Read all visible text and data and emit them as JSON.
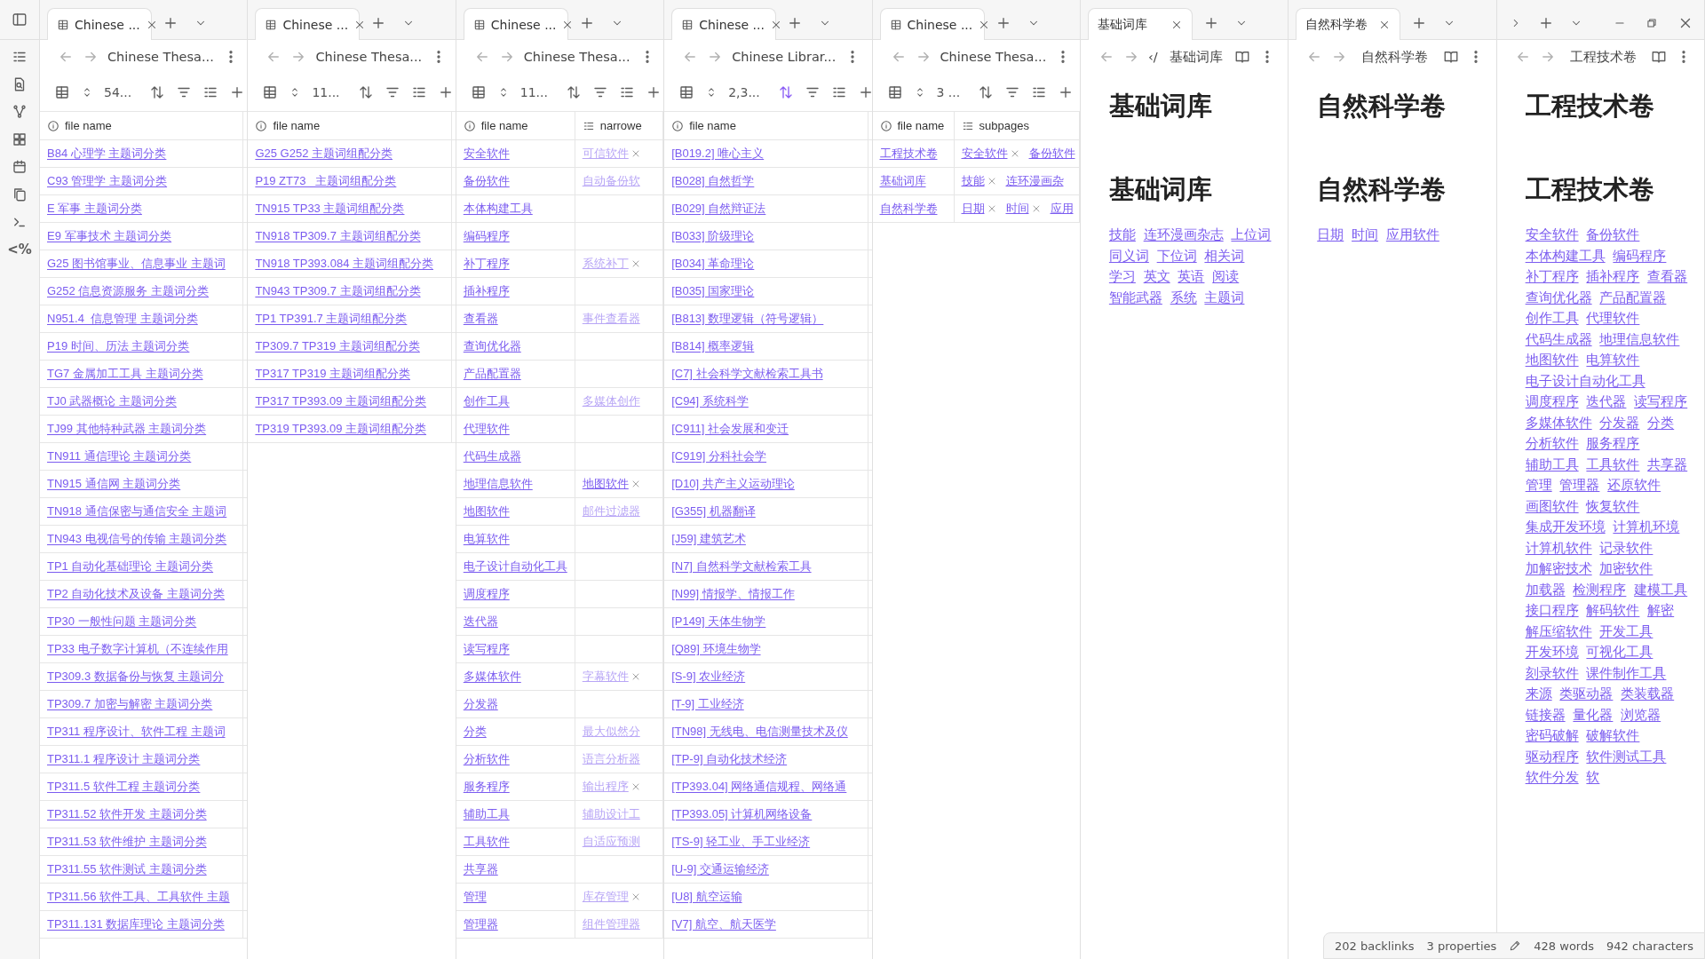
{
  "ribbon": {
    "icons": [
      {
        "kind": "sidebar"
      },
      {
        "kind": "list"
      },
      {
        "kind": "file-search"
      },
      {
        "kind": "graph"
      },
      {
        "kind": "grid"
      },
      {
        "kind": "calendar"
      },
      {
        "kind": "copy"
      },
      {
        "kind": "terminal"
      },
      {
        "kind": "text",
        "label": "<%"
      }
    ]
  },
  "panes": [
    {
      "kind": "table",
      "tab_bar": {
        "tab": {
          "title": "Chinese ..."
        }
      },
      "nav": {
        "title": "Chinese Thesa..."
      },
      "toolbar": {
        "count": "54...",
        "sort_active": false
      },
      "columns": [
        {
          "label": "file name",
          "kind": "file"
        }
      ],
      "rows": [
        {
          "name": "B84 心理学 主题词分类"
        },
        {
          "name": "C93 管理学 主题词分类"
        },
        {
          "name": "E 军事 主题词分类"
        },
        {
          "name": "E9 军事技术 主题词分类"
        },
        {
          "name": "G25 图书馆事业、信息事业 主题词"
        },
        {
          "name": "G252 信息资源服务 主题词分类"
        },
        {
          "name": "N951.4_信息管理 主题词分类"
        },
        {
          "name": "P19 时间、历法 主题词分类"
        },
        {
          "name": "TG7 金属加工工具 主题词分类"
        },
        {
          "name": "TJ0 武器概论 主题词分类"
        },
        {
          "name": "TJ99 其他特种武器 主题词分类"
        },
        {
          "name": "TN911 通信理论 主题词分类"
        },
        {
          "name": "TN915 通信网 主题词分类"
        },
        {
          "name": "TN918 通信保密与通信安全 主题词"
        },
        {
          "name": "TN943 电视信号的传输 主题词分类"
        },
        {
          "name": "TP1 自动化基础理论 主题词分类"
        },
        {
          "name": "TP2 自动化技术及设备 主题词分类"
        },
        {
          "name": "TP30 一般性问题 主题词分类"
        },
        {
          "name": "TP33 电子数字计算机（不连续作用"
        },
        {
          "name": "TP309.3 数据备份与恢复 主题词分"
        },
        {
          "name": "TP309.7 加密与解密 主题词分类"
        },
        {
          "name": "TP311 程序设计、软件工程 主题词"
        },
        {
          "name": "TP311.1 程序设计 主题词分类"
        },
        {
          "name": "TP311.5 软件工程 主题词分类"
        },
        {
          "name": "TP311.52 软件开发 主题词分类"
        },
        {
          "name": "TP311.53 软件维护 主题词分类"
        },
        {
          "name": "TP311.55 软件测试 主题词分类"
        },
        {
          "name": "TP311.56 软件工具、工具软件 主题"
        },
        {
          "name": "TP311.131 数据库理论 主题词分类"
        }
      ]
    },
    {
      "kind": "table",
      "tab_bar": {
        "tab": {
          "title": "Chinese ..."
        }
      },
      "nav": {
        "title": "Chinese Thesa..."
      },
      "toolbar": {
        "count": "11...",
        "sort_active": false
      },
      "columns": [
        {
          "label": "file name",
          "kind": "file"
        }
      ],
      "rows": [
        {
          "name": "G25 G252 主题词组配分类"
        },
        {
          "name": "P19 ZT73_ 主题词组配分类"
        },
        {
          "name": "TN915 TP33 主题词组配分类"
        },
        {
          "name": "TN918 TP309.7 主题词组配分类"
        },
        {
          "name": "TN918 TP393.084 主题词组配分类"
        },
        {
          "name": "TN943 TP309.7 主题词组配分类"
        },
        {
          "name": "TP1 TP391.7 主题词组配分类"
        },
        {
          "name": "TP309.7 TP319 主题词组配分类"
        },
        {
          "name": "TP317 TP319 主题词组配分类"
        },
        {
          "name": "TP317 TP393.09 主题词组配分类"
        },
        {
          "name": "TP319 TP393.09 主题词组配分类"
        }
      ]
    },
    {
      "kind": "table",
      "tab_bar": {
        "tab": {
          "title": "Chinese ..."
        }
      },
      "nav": {
        "title": "Chinese Thesa..."
      },
      "toolbar": {
        "count": "11...",
        "sort_active": false
      },
      "columns": [
        {
          "label": "file name",
          "kind": "file"
        },
        {
          "label": "narrowe",
          "kind": "list"
        }
      ],
      "rows": [
        {
          "name": "安全软件",
          "chips": [
            {
              "text": "可信软件",
              "resolved": false,
              "removable": true
            }
          ]
        },
        {
          "name": "备份软件",
          "chips": [
            {
              "text": "自动备份软",
              "resolved": false,
              "removable": false
            }
          ]
        },
        {
          "name": "本体构建工具"
        },
        {
          "name": "编码程序"
        },
        {
          "name": "补丁程序",
          "chips": [
            {
              "text": "系统补丁",
              "resolved": false,
              "removable": true
            }
          ]
        },
        {
          "name": "插补程序"
        },
        {
          "name": "查看器",
          "chips": [
            {
              "text": "事件查看器",
              "resolved": false,
              "removable": false
            }
          ]
        },
        {
          "name": "查询优化器"
        },
        {
          "name": "产品配置器"
        },
        {
          "name": "创作工具",
          "chips": [
            {
              "text": "多媒体创作",
              "resolved": false,
              "removable": false
            }
          ]
        },
        {
          "name": "代理软件"
        },
        {
          "name": "代码生成器"
        },
        {
          "name": "地理信息软件",
          "chips": [
            {
              "text": "地图软件",
              "resolved": true,
              "removable": true
            }
          ]
        },
        {
          "name": "地图软件",
          "chips": [
            {
              "text": "邮件过滤器",
              "resolved": false,
              "removable": false
            }
          ]
        },
        {
          "name": "电算软件"
        },
        {
          "name": "电子设计自动化工具"
        },
        {
          "name": "调度程序"
        },
        {
          "name": "迭代器"
        },
        {
          "name": "读写程序"
        },
        {
          "name": "多媒体软件",
          "chips": [
            {
              "text": "字幕软件",
              "resolved": false,
              "removable": true
            }
          ]
        },
        {
          "name": "分发器"
        },
        {
          "name": "分类",
          "chips": [
            {
              "text": "最大似然分",
              "resolved": false,
              "removable": false
            }
          ]
        },
        {
          "name": "分析软件",
          "chips": [
            {
              "text": "语言分析器",
              "resolved": false,
              "removable": false
            }
          ]
        },
        {
          "name": "服务程序",
          "chips": [
            {
              "text": "输出程序",
              "resolved": false,
              "removable": true
            }
          ]
        },
        {
          "name": "辅助工具",
          "chips": [
            {
              "text": "辅助设计工",
              "resolved": false,
              "removable": false
            }
          ]
        },
        {
          "name": "工具软件",
          "chips": [
            {
              "text": "自适应预测",
              "resolved": false,
              "removable": false
            }
          ]
        },
        {
          "name": "共享器"
        },
        {
          "name": "管理",
          "chips": [
            {
              "text": "库存管理",
              "resolved": false,
              "removable": true
            }
          ]
        },
        {
          "name": "管理器",
          "chips": [
            {
              "text": "组件管理器",
              "resolved": false,
              "removable": false
            }
          ]
        }
      ]
    },
    {
      "kind": "table",
      "tab_bar": {
        "tab": {
          "title": "Chinese ..."
        }
      },
      "nav": {
        "title": "Chinese Librar..."
      },
      "toolbar": {
        "count": "2,3...",
        "sort_active": true
      },
      "columns": [
        {
          "label": "file name",
          "kind": "file"
        }
      ],
      "rows": [
        {
          "name": "[B019.2] 唯心主义"
        },
        {
          "name": "[B028] 自然哲学"
        },
        {
          "name": "[B029] 自然辩证法"
        },
        {
          "name": "[B033] 阶级理论"
        },
        {
          "name": "[B034] 革命理论"
        },
        {
          "name": "[B035] 国家理论"
        },
        {
          "name": "[B813] 数理逻辑（符号逻辑）"
        },
        {
          "name": "[B814] 概率逻辑"
        },
        {
          "name": "[C7] 社会科学文献检索工具书"
        },
        {
          "name": "[C94] 系统科学"
        },
        {
          "name": "[C911] 社会发展和变迁"
        },
        {
          "name": "[C919] 分科社会学"
        },
        {
          "name": "[D10] 共产主义运动理论"
        },
        {
          "name": "[G355] 机器翻译"
        },
        {
          "name": "[J59] 建筑艺术"
        },
        {
          "name": "[N7] 自然科学文献检索工具"
        },
        {
          "name": "[N99] 情报学、情报工作"
        },
        {
          "name": "[P149] 天体生物学"
        },
        {
          "name": "[Q89] 环境生物学"
        },
        {
          "name": "[S-9] 农业经济"
        },
        {
          "name": "[T-9] 工业经济"
        },
        {
          "name": "[TN98] 无线电、电信测量技术及仪"
        },
        {
          "name": "[TP-9] 自动化技术经济"
        },
        {
          "name": "[TP393.04] 网络通信规程、网络通"
        },
        {
          "name": "[TP393.05] 计算机网络设备"
        },
        {
          "name": "[TS-9] 轻工业、手工业经济"
        },
        {
          "name": "[U-9] 交通运输经济"
        },
        {
          "name": "[U8] 航空运输"
        },
        {
          "name": "[V7] 航空、航天医学"
        }
      ]
    },
    {
      "kind": "table",
      "tab_bar": {
        "tab": {
          "title": "Chinese ..."
        }
      },
      "nav": {
        "title": "Chinese Thesa..."
      },
      "toolbar": {
        "count": "3 ...",
        "sort_active": false
      },
      "columns": [
        {
          "label": "file name",
          "kind": "file"
        },
        {
          "label": "subpages",
          "kind": "list"
        }
      ],
      "rows": [
        {
          "name": "工程技术卷",
          "chips": [
            {
              "text": "安全软件",
              "resolved": true,
              "removable": true
            },
            {
              "text": "备份软件",
              "resolved": true,
              "removable": false
            }
          ]
        },
        {
          "name": "基础词库",
          "chips": [
            {
              "text": "技能",
              "resolved": true,
              "removable": true
            },
            {
              "text": "连环漫画杂",
              "resolved": true,
              "removable": false
            }
          ]
        },
        {
          "name": "自然科学卷",
          "chips": [
            {
              "text": "日期",
              "resolved": true,
              "removable": true
            },
            {
              "text": "时间",
              "resolved": true,
              "removable": true
            },
            {
              "text": "应用",
              "resolved": true,
              "removable": false
            }
          ]
        }
      ]
    },
    {
      "kind": "note",
      "tab_bar": {
        "tab": {
          "title": "基础词库"
        }
      },
      "nav": {
        "crumb": "‹/",
        "title": "基础词库"
      },
      "inline_title": "基础词库",
      "heading": "基础词库",
      "links": [
        "技能",
        "连环漫画杂志",
        "上位词",
        "同义词",
        "下位词",
        "相关词",
        "学习",
        "英文",
        "英语",
        "阅读",
        "智能武器",
        "系统",
        "主题词"
      ]
    },
    {
      "kind": "note",
      "tab_bar": {
        "tab": {
          "title": "自然科学卷"
        }
      },
      "nav": {
        "title": "自然科学卷"
      },
      "inline_title": "自然科学卷",
      "heading": "自然科学卷",
      "links": [
        "日期",
        "时间",
        "应用软件"
      ]
    },
    {
      "kind": "note",
      "tab_bar": {
        "overflow": true,
        "window_controls": true
      },
      "nav": {
        "title": "工程技术卷"
      },
      "inline_title": "工程技术卷",
      "heading": "工程技术卷",
      "links": [
        "安全软件",
        "备份软件",
        "本体构建工具",
        "编码程序",
        "补丁程序",
        "插补程序",
        "查看器",
        "查询优化器",
        "产品配置器",
        "创作工具",
        "代理软件",
        "代码生成器",
        "地理信息软件",
        "地图软件",
        "电算软件",
        "电子设计自动化工具",
        "调度程序",
        "迭代器",
        "读写程序",
        "多媒体软件",
        "分发器",
        "分类",
        "分析软件",
        "服务程序",
        "辅助工具",
        "工具软件",
        "共享器",
        "管理",
        "管理器",
        "还原软件",
        "画图软件",
        "恢复软件",
        "集成开发环境",
        "计算机环境",
        "计算机软件",
        "记录软件",
        "加解密技术",
        "加密软件",
        "加载器",
        "检测程序",
        "建模工具",
        "接口程序",
        "解码软件",
        "解密",
        "解压缩软件",
        "开发工具",
        "开发环境",
        "可视化工具",
        "刻录软件",
        "课件制作工具",
        "来源",
        "类驱动器",
        "类装载器",
        "链接器",
        "量化器",
        "浏览器",
        "密码破解",
        "破解软件",
        "驱动程序",
        "软件测试工具",
        "软件分发",
        "软"
      ]
    }
  ],
  "status_bar": {
    "backlinks": "202 backlinks",
    "properties": "3 properties",
    "words": "428 words",
    "characters": "942 characters"
  }
}
